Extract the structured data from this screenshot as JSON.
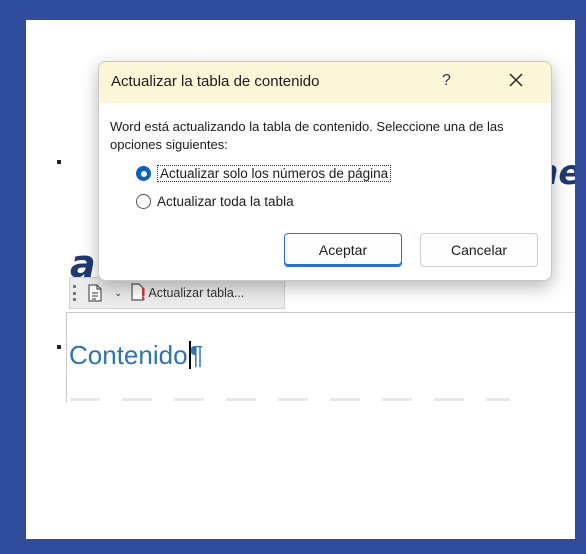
{
  "dialog": {
    "title": "Actualizar la tabla de contenido",
    "help_label": "?",
    "close_icon": "close-icon",
    "message": "Word está actualizando la tabla de contenido. Seleccione una de las opciones siguientes:",
    "options": [
      {
        "label": "Actualizar solo los números de página",
        "selected": true
      },
      {
        "label": "Actualizar toda la tabla",
        "selected": false
      }
    ],
    "ok_label": "Aceptar",
    "cancel_label": "Cancelar"
  },
  "document": {
    "heading_fragment": "accesibles",
    "heading_pilcrow": "¶",
    "heading_right_fragment": "me",
    "toc_title": "Contenido",
    "toc_pilcrow": "¶"
  },
  "content_control_toolbar": {
    "update_table_label": "Actualizar tabla...",
    "icons": [
      "grip-icon",
      "toc-document-icon",
      "chevron-down-icon",
      "update-table-icon"
    ]
  },
  "colors": {
    "frame": "#2f4d9c",
    "titlebar": "#fbf6d8",
    "accent": "#0e5fb8",
    "heading": "#1f3a70",
    "toc_title": "#2e74b5"
  }
}
